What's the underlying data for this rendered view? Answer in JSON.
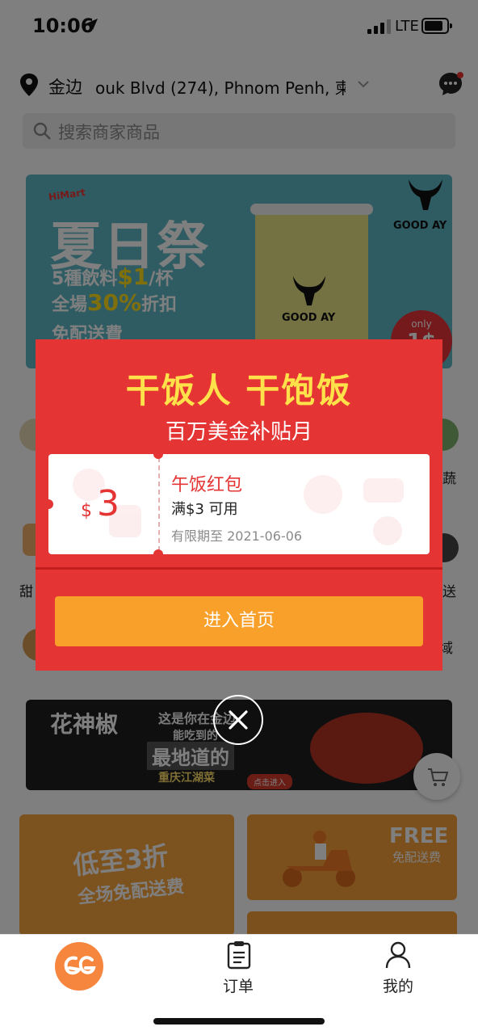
{
  "status_bar": {
    "time": "10:06",
    "network": "LTE"
  },
  "location": {
    "label": "金边",
    "address": "ouk Blvd (274), Phnom Penh, 柬埔"
  },
  "search": {
    "placeholder": "搜索商家商品"
  },
  "main_banner": {
    "tag": "HiMart",
    "title": "夏日祭",
    "line1_prefix": "5種飲料",
    "line1_highlight": "$1",
    "line1_suffix": "/杯",
    "line2_prefix": "全場",
    "line2_highlight": "30%",
    "line2_suffix": "折扣",
    "line3": "免配送費",
    "brand": "GOOD AY",
    "badge_top": "only",
    "badge_value": "1$"
  },
  "categories": {
    "right_top": "蔬",
    "left_mid": "甜",
    "right_mid": "送",
    "right_low": "域"
  },
  "dark_banner": {
    "line1": "这是你在金边",
    "line2": "能吃到的",
    "line3": "最地道的",
    "line4": "重庆江湖菜",
    "button": "点击进入",
    "brush_text": "花神椒"
  },
  "promo_left": {
    "title": "低至3折",
    "subtitle": "全场免配送费"
  },
  "promo_right": {
    "title": "FREE",
    "subtitle": "免配送费"
  },
  "popup": {
    "title": "干饭人 干饱饭",
    "subtitle": "百万美金补贴月",
    "coupon": {
      "currency": "$",
      "amount": "3",
      "name": "午饭红包",
      "condition": "满$3 可用",
      "expiry": "有限期至 2021-06-06"
    },
    "button": "进入首页"
  },
  "tab_bar": {
    "orders_label": "订单",
    "me_label": "我的"
  },
  "colors": {
    "popup_red": "#e43434",
    "title_yellow": "#ffe24a",
    "button_orange": "#f8a02a",
    "brand_orange": "#f6853d"
  }
}
